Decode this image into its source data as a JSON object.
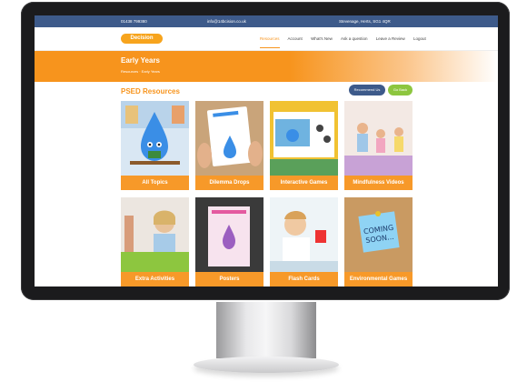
{
  "topbar": {
    "phone": "01438 799380",
    "email": "info@14bcision.co.uk",
    "address": "Stevenage, Herts, SG1 4QR"
  },
  "nav": {
    "logo": "Decision",
    "links": [
      "Resources",
      "Account",
      "What's New",
      "Ask a question",
      "Leave a Review",
      "Logout"
    ]
  },
  "hero": {
    "title": "Early Years",
    "breadcrumb": "Resources  ·  Early Years"
  },
  "section": {
    "title": "PSED Resources",
    "recommend_button": "Recommend Us",
    "back_button": "Go Back"
  },
  "tiles": [
    {
      "label": "All Topics"
    },
    {
      "label": "Dilemma Drops"
    },
    {
      "label": "Interactive Games"
    },
    {
      "label": "Mindfulness Videos"
    },
    {
      "label": "Extra Activities"
    },
    {
      "label": "Posters"
    },
    {
      "label": "Flash Cards"
    },
    {
      "label": "Environmental Games"
    }
  ],
  "colors": {
    "accent": "#f7941d",
    "brand_blue": "#3d5a8a",
    "green": "#8dc63f"
  }
}
